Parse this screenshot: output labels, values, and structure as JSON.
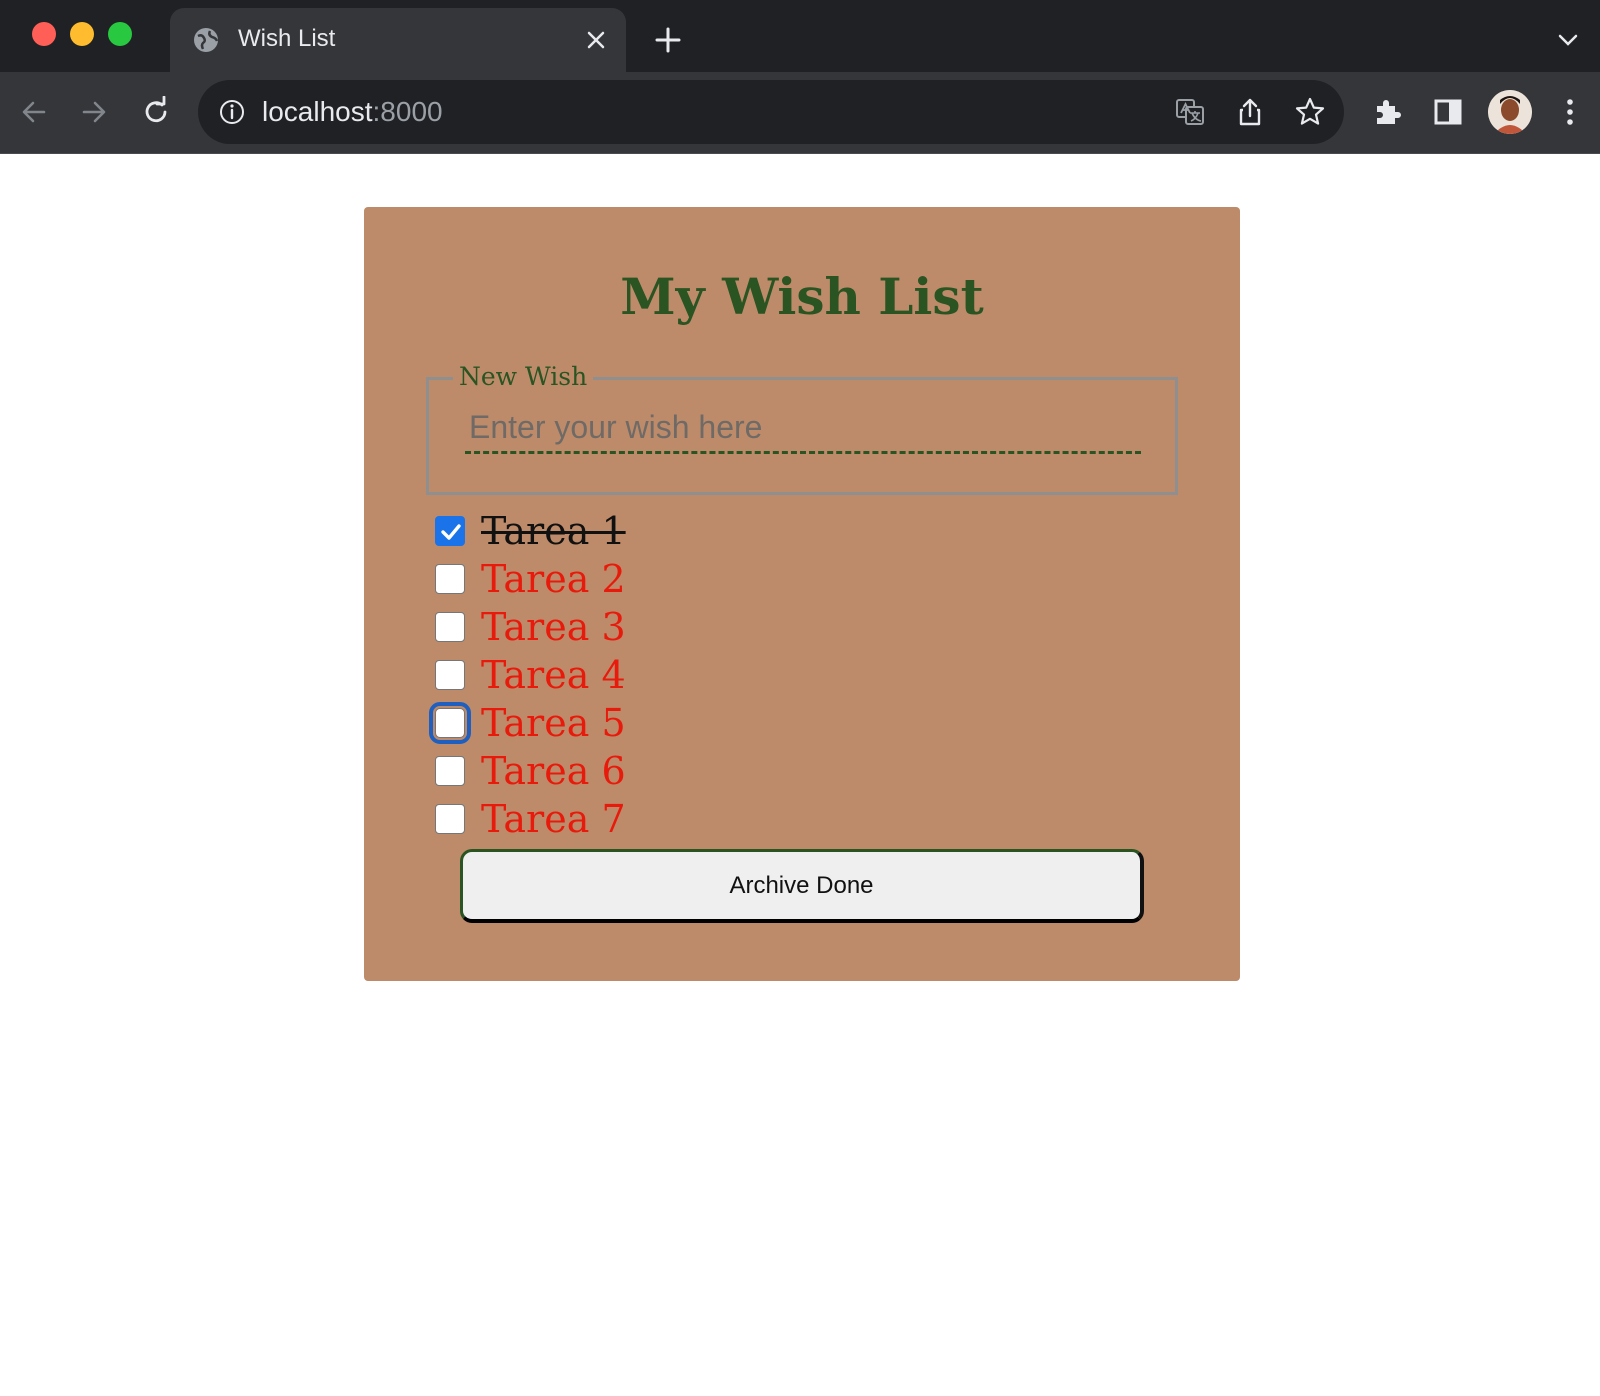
{
  "browser": {
    "tab_title": "Wish List",
    "url_host": "localhost",
    "url_port": ":8000"
  },
  "page": {
    "title": "My Wish List",
    "new_wish": {
      "legend": "New Wish",
      "placeholder": "Enter your wish here",
      "value": ""
    },
    "wishes": [
      {
        "label": "Tarea 1",
        "done": true
      },
      {
        "label": "Tarea 2",
        "done": false
      },
      {
        "label": "Tarea 3",
        "done": false
      },
      {
        "label": "Tarea 4",
        "done": false
      },
      {
        "label": "Tarea 5",
        "done": false,
        "focused": true
      },
      {
        "label": "Tarea 6",
        "done": false
      },
      {
        "label": "Tarea 7",
        "done": false
      }
    ],
    "archive_button": "Archive Done"
  },
  "colors": {
    "card_background": "#bd8b6a",
    "title_green": "#2a5422",
    "pending_red": "#e81a0c",
    "checkbox_blue": "#1a73e8"
  }
}
